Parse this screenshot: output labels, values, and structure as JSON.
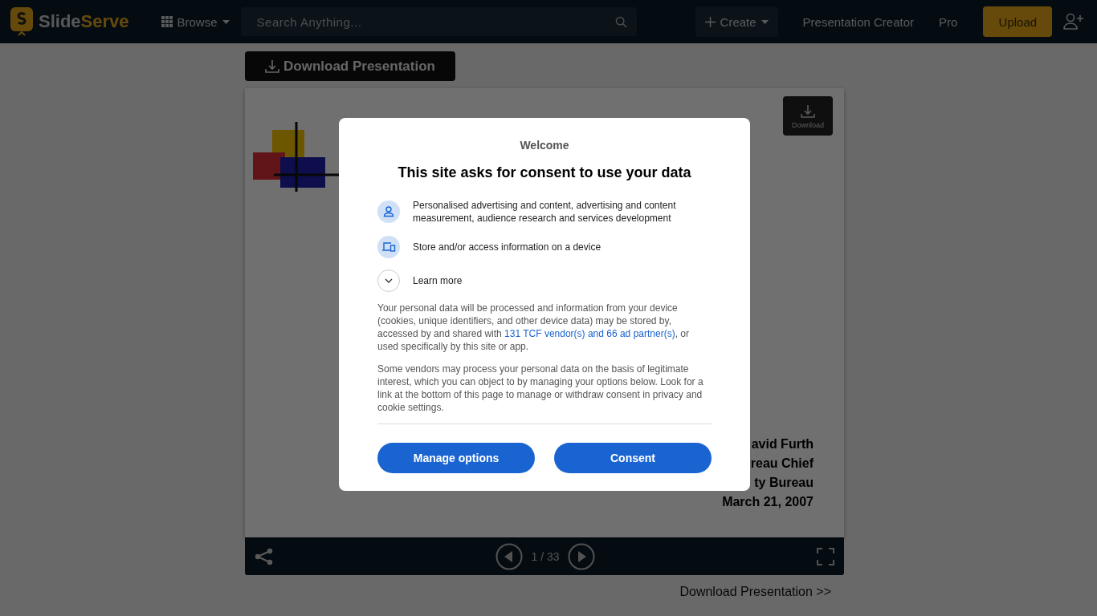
{
  "header": {
    "logo": {
      "first": "Slide",
      "second": "Serve"
    },
    "browse": "Browse",
    "search": {
      "placeholder": "Search Anything..."
    },
    "create": "Create",
    "links": [
      "Presentation Creator",
      "Pro"
    ],
    "upload": "Upload"
  },
  "download_button": "Download Presentation",
  "slide": {
    "download": "Download",
    "lines": [
      "avid Furth",
      "reau Chief",
      "ty Bureau",
      "March 21, 2007"
    ]
  },
  "player": {
    "page": "1 / 33"
  },
  "download_link": "Download Presentation >>",
  "dialog": {
    "welcome": "Welcome",
    "title": "This site asks for consent to use your data",
    "purposes": [
      {
        "kind": "person",
        "text": "Personalised advertising and content, advertising and content measurement, audience research and services development"
      },
      {
        "kind": "device",
        "text": "Store and/or access information on a device"
      }
    ],
    "learn_more": {
      "label": "Learn more",
      "expanded": false
    },
    "paragraph_1": {
      "before": "Your personal data will be processed and information from your device (cookies, unique identifiers, and other device data) may be stored by, accessed by and shared with ",
      "link": "131 TCF vendor(s) and 66 ad partner(s)",
      "after": ", or used specifically by this site or app."
    },
    "paragraph_2": "Some vendors may process your personal data on the basis of legitimate interest, which you can object to by managing your options below. Look for a link at the bottom of this page to manage or withdraw consent in privacy and cookie settings.",
    "buttons": [
      "Manage options",
      "Consent"
    ]
  }
}
